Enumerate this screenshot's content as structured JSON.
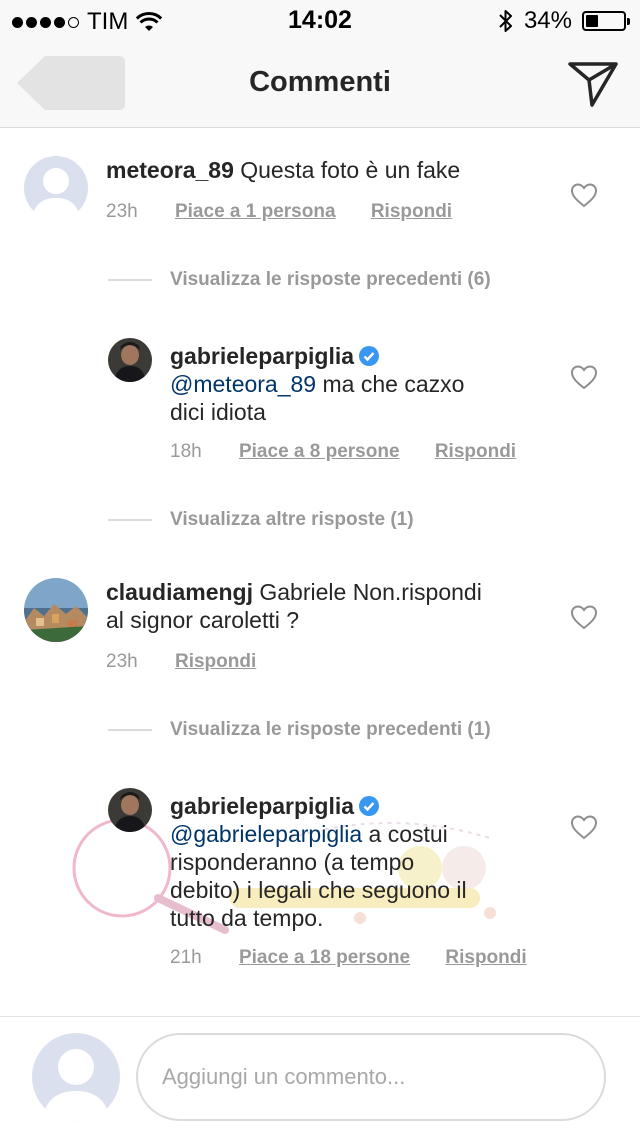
{
  "status_bar": {
    "carrier": "TIM",
    "time": "14:02",
    "battery_percent": "34%",
    "battery_level": 0.34,
    "signal_bars_filled": 4,
    "signal_bars_total": 5
  },
  "nav": {
    "title": "Commenti",
    "back_icon": "back-arrow-icon",
    "send_icon": "paper-plane-icon"
  },
  "comments": [
    {
      "username": "meteora_89",
      "text": "Questa foto è un fake",
      "time": "23h",
      "likes": "Piace a 1 persona",
      "reply": "Rispondi",
      "toggle": "Visualizza le risposte precedenti (6)"
    },
    {
      "username": "gabrieleparpiglia",
      "mention": "@meteora_89",
      "text_line1": "ma che cazxo",
      "text_line2": "dici idiota",
      "time": "18h",
      "likes": "Piace a 8 persone",
      "reply": "Rispondi",
      "toggle": "Visualizza altre risposte (1)"
    },
    {
      "username": "claudiamengj",
      "text_line1": "Gabriele Non.rispondi",
      "text_line2": "al signor caroletti ?",
      "time": "23h",
      "reply": "Rispondi",
      "toggle": "Visualizza le risposte precedenti (1)"
    },
    {
      "username": "gabrieleparpiglia",
      "mention": "@gabrieleparpiglia",
      "text_line1": "a costui",
      "text_line2": "risponderanno (a tempo",
      "text_line3": "debito) i legali che seguono il",
      "text_line4": "tutto da tempo.",
      "time": "21h",
      "likes": "Piace a 18 persone",
      "reply": "Rispondi"
    }
  ],
  "input": {
    "placeholder": "Aggiungi un commento..."
  },
  "colors": {
    "mention": "#003569",
    "verified": "#3897f0",
    "meta": "#999999"
  }
}
